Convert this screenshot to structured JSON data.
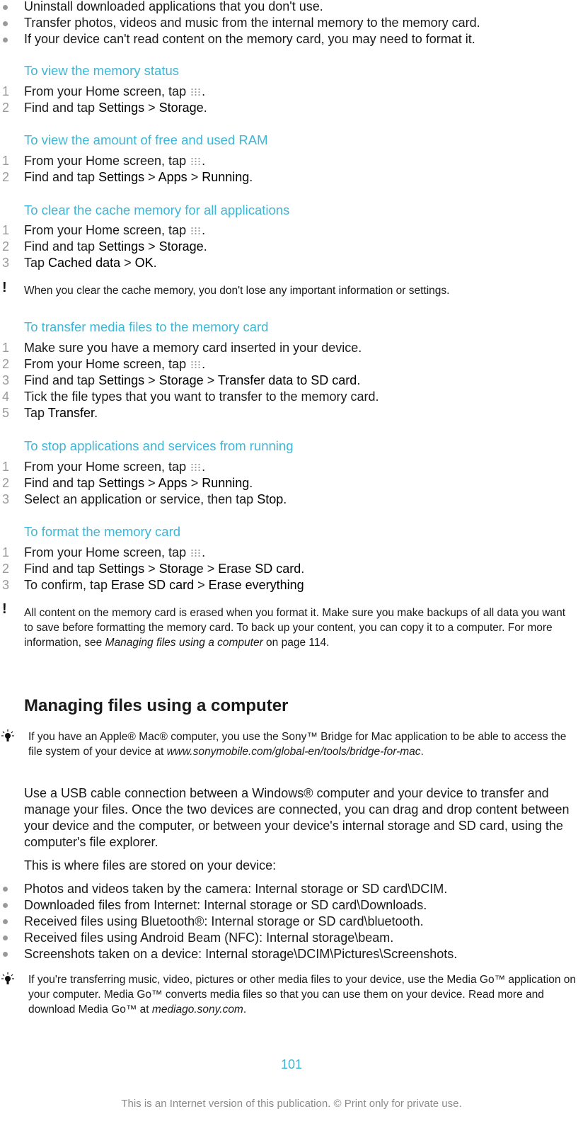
{
  "top_bullets": [
    "Uninstall downloaded applications that you don't use.",
    "Transfer photos, videos and music from the internal memory to the memory card.",
    "If your device can't read content on the memory card, you may need to format it."
  ],
  "sections": {
    "memory_status": {
      "title": "To view the memory status",
      "steps": [
        {
          "n": "1",
          "text": "From your Home screen, tap ",
          "end": "."
        },
        {
          "n": "2",
          "pre": "Find and tap ",
          "b1": "Settings",
          "sep1": " > ",
          "b2": "Storage",
          "end": "."
        }
      ]
    },
    "ram": {
      "title": "To view the amount of free and used RAM",
      "steps": [
        {
          "n": "1",
          "text": "From your Home screen, tap ",
          "end": "."
        },
        {
          "n": "2",
          "pre": "Find and tap ",
          "b1": "Settings",
          "sep1": " > ",
          "b2": "Apps",
          "sep2": " > ",
          "b3": "Running",
          "end": "."
        }
      ]
    },
    "cache": {
      "title": "To clear the cache memory for all applications",
      "steps": [
        {
          "n": "1",
          "text": "From your Home screen, tap ",
          "end": "."
        },
        {
          "n": "2",
          "pre": "Find and tap ",
          "b1": "Settings",
          "sep1": " > ",
          "b2": "Storage",
          "end": "."
        },
        {
          "n": "3",
          "pre": "Tap ",
          "b1": "Cached data",
          "sep1": " > ",
          "b2": "OK",
          "end": "."
        }
      ],
      "note": "When you clear the cache memory, you don't lose any important information or settings."
    },
    "transfer": {
      "title": "To transfer media files to the memory card",
      "steps": [
        {
          "n": "1",
          "text": "Make sure you have a memory card inserted in your device."
        },
        {
          "n": "2",
          "text": "From your Home screen, tap ",
          "end": "."
        },
        {
          "n": "3",
          "pre": "Find and tap ",
          "b1": "Settings",
          "sep1": " > ",
          "b2": "Storage",
          "sep2": " > ",
          "b3": "Transfer data to SD card",
          "end": "."
        },
        {
          "n": "4",
          "text": "Tick the file types that you want to transfer to the memory card."
        },
        {
          "n": "5",
          "pre": "Tap ",
          "b1": "Transfer",
          "end": "."
        }
      ]
    },
    "stop": {
      "title": "To stop applications and services from running",
      "steps": [
        {
          "n": "1",
          "text": "From your Home screen, tap ",
          "end": "."
        },
        {
          "n": "2",
          "pre": "Find and tap ",
          "b1": "Settings",
          "sep1": " > ",
          "b2": "Apps",
          "sep2": " > ",
          "b3": "Running",
          "end": "."
        },
        {
          "n": "3",
          "pre": "Select an application or service, then tap ",
          "b1": "Stop",
          "end": "."
        }
      ]
    },
    "format": {
      "title": "To format the memory card",
      "steps": [
        {
          "n": "1",
          "text": "From your Home screen, tap ",
          "end": "."
        },
        {
          "n": "2",
          "pre": "Find and tap ",
          "b1": "Settings",
          "sep1": " > ",
          "b2": "Storage",
          "sep2": " > ",
          "b3": "Erase SD card",
          "end": "."
        },
        {
          "n": "3",
          "pre": "To confirm, tap ",
          "b1": "Erase SD card",
          "sep1": " > ",
          "b2": "Erase everything"
        }
      ],
      "note_pre": "All content on the memory card is erased when you format it. Make sure you make backups of all data you want to save before formatting the memory card. To back up your content, you can copy it to a computer. For more information, see ",
      "note_link": "Managing files using a computer",
      "note_post": " on page 114."
    }
  },
  "managing": {
    "title": "Managing files using a computer",
    "tip1_pre": "If you have an Apple® Mac® computer, you use the Sony™ Bridge for Mac application to be able to access the file system of your device at ",
    "tip1_link": "www.sonymobile.com/global-en/tools/bridge-for-mac",
    "tip1_post": ".",
    "para1": "Use a USB cable connection between a Windows® computer and your device to transfer and manage your files. Once the two devices are connected, you can drag and drop content between your device and the computer, or between your device's internal storage and SD card, using the computer's file explorer.",
    "para2": "This is where files are stored on your device:",
    "locations": [
      "Photos and videos taken by the camera: Internal storage or SD card\\DCIM.",
      "Downloaded files from Internet: Internal storage or SD card\\Downloads.",
      "Received files using Bluetooth®: Internal storage or SD card\\bluetooth.",
      "Received files using Android Beam (NFC): Internal storage\\beam.",
      "Screenshots taken on a device: Internal storage\\DCIM\\Pictures\\Screenshots."
    ],
    "tip2_pre": "If you're transferring music, video, pictures or other media files to your device, use the Media Go™ application on your computer. Media Go™ converts media files so that you can use them on your device. Read more and download Media Go™ at ",
    "tip2_link": "mediago.sony.com",
    "tip2_post": "."
  },
  "page_number": "101",
  "footer": "This is an Internet version of this publication. © Print only for private use.",
  "colors": {
    "heading": "#3eb6d6",
    "number": "#9a9a9a",
    "text": "#1a1a1a"
  }
}
